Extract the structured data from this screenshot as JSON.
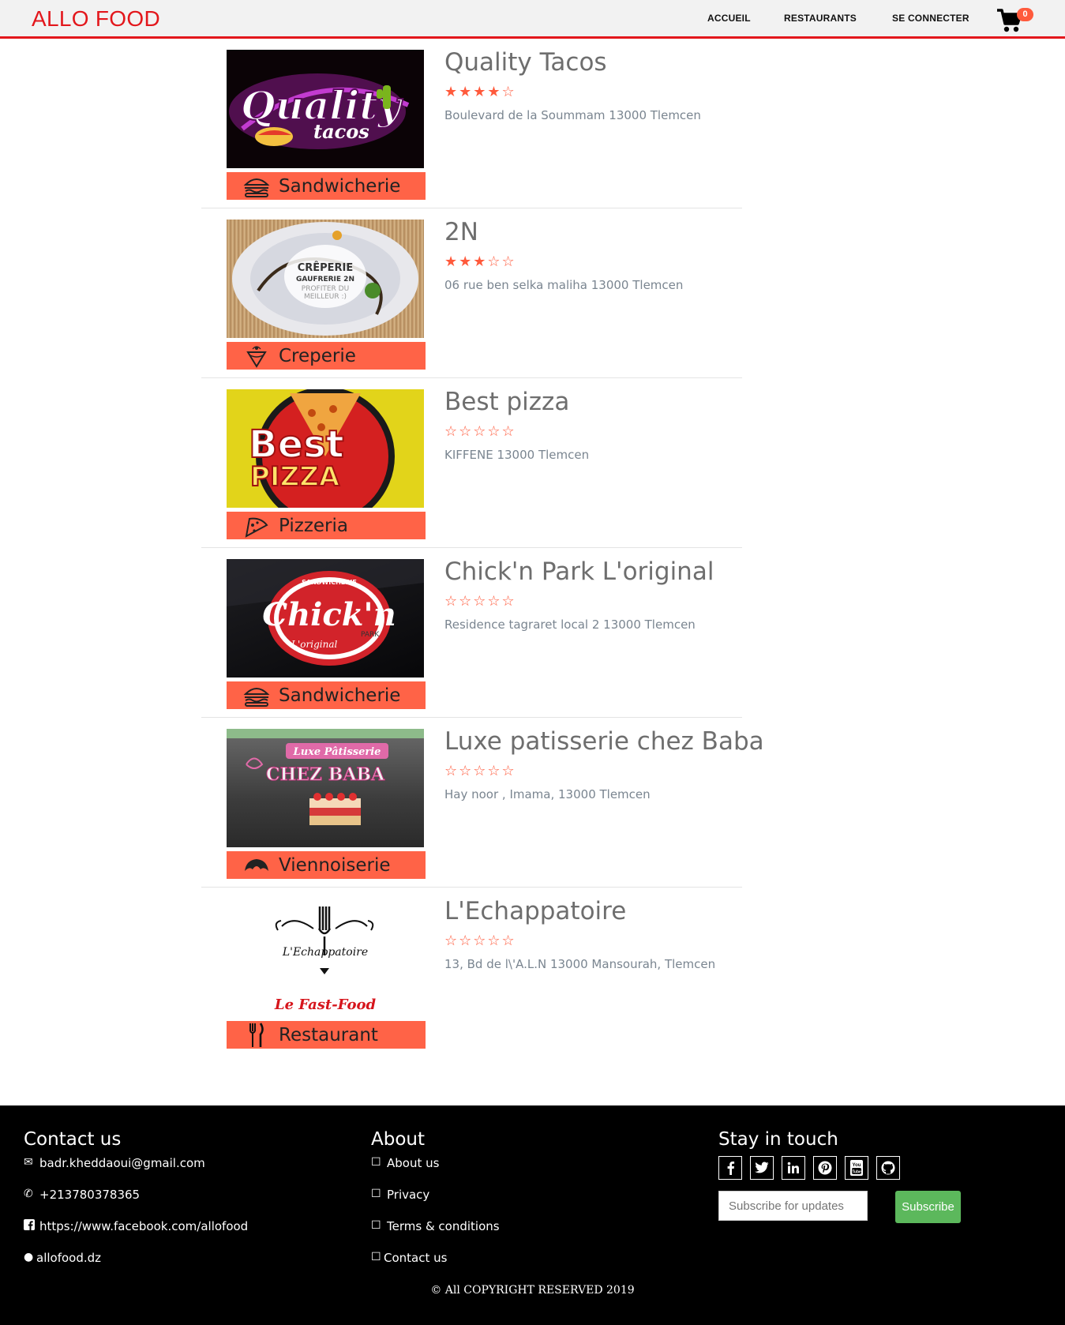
{
  "nav": {
    "brand": "ALLO FOOD",
    "links": [
      "ACCUEIL",
      "RESTAURANTS",
      "SE CONNECTER"
    ],
    "cart_count": "0",
    "cart_icon": "shopping-cart-icon"
  },
  "colors": {
    "brand": "#e3171c",
    "category_bg": "#ff6347",
    "star": "#ff5a3c",
    "subscribe": "#5cb85c"
  },
  "restaurants": [
    {
      "name": "Quality Tacos",
      "rating": 4,
      "stars": "★★★★☆",
      "address": "Boulevard de la Soummam 13000 Tlemcen",
      "category": "Sandwicherie",
      "category_icon": "burger-icon",
      "logo_text": [
        "Quality",
        "tacos"
      ]
    },
    {
      "name": "2N",
      "rating": 3,
      "stars": "★★★☆☆",
      "address": "06 rue ben selka maliha 13000 Tlemcen",
      "category": "Creperie",
      "category_icon": "crepe-icon",
      "logo_text": [
        "CRÊPERIE",
        "GAUFRERIE 2N",
        "PROFITER DU",
        "MEILLEUR :)"
      ]
    },
    {
      "name": "Best pizza",
      "rating": 0,
      "stars": "☆☆☆☆☆",
      "address": "KIFFENE 13000 Tlemcen",
      "category": "Pizzeria",
      "category_icon": "pizza-slice-icon",
      "logo_text": [
        "Best",
        "PIZZA"
      ]
    },
    {
      "name": "Chick'n Park L'original",
      "rating": 0,
      "stars": "☆☆☆☆☆",
      "address": "Residence tagraret local 2 13000 Tlemcen",
      "category": "Sandwicherie",
      "category_icon": "burger-icon",
      "logo_text": [
        "SANDWICHERIE",
        "Chick'n",
        "PARK",
        "L'original"
      ]
    },
    {
      "name": "Luxe patisserie chez Baba",
      "rating": 0,
      "stars": "☆☆☆☆☆",
      "address": "Hay noor , Imama, 13000 Tlemcen",
      "category": "Viennoiserie",
      "category_icon": "croissant-icon",
      "logo_text": [
        "Luxe Pâtisserie",
        "CHEZ BABA"
      ]
    },
    {
      "name": "L'Echappatoire",
      "rating": 0,
      "stars": "☆☆☆☆☆",
      "address": "13, Bd de l\\'A.L.N 13000 Mansourah, Tlemcen",
      "category": "Restaurant",
      "category_icon": "fork-knife-icon",
      "logo_text": [
        "L'Echappatoire",
        "Le Fast-Food"
      ]
    }
  ],
  "footer": {
    "contact": {
      "title": "Contact us",
      "items": [
        {
          "icon": "envelope-icon",
          "text": "badr.kheddaoui@gmail.com"
        },
        {
          "icon": "phone-icon",
          "text": "+213780378365"
        },
        {
          "icon": "facebook-square-icon",
          "text": "https://www.facebook.com/allofood"
        },
        {
          "icon": "globe-icon",
          "text": "allofood.dz"
        }
      ]
    },
    "about": {
      "title": "About",
      "items": [
        "About us",
        "Privacy",
        "Terms & conditions",
        "Contact us"
      ]
    },
    "stay": {
      "title": "Stay in touch",
      "social": [
        "facebook-icon",
        "twitter-icon",
        "linkedin-icon",
        "pinterest-icon",
        "youtube-icon",
        "github-icon"
      ],
      "subscribe_placeholder": "Subscribe for updates",
      "subscribe_button": "Subscribe"
    },
    "copyright": "© All COPYRIGHT RESERVED 2019"
  }
}
